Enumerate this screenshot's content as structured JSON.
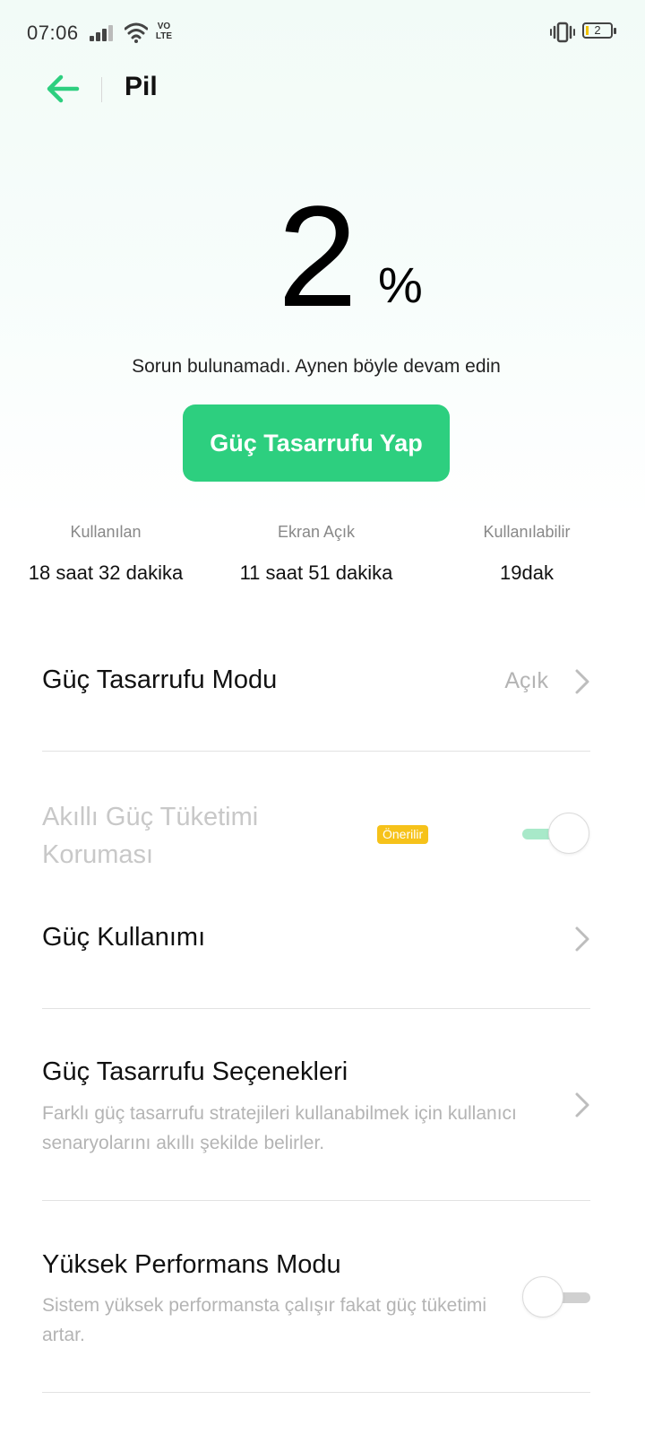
{
  "status_bar": {
    "time": "07:06",
    "network_icon_text": "VO LTE",
    "battery_level": "2"
  },
  "header": {
    "title": "Pil"
  },
  "battery": {
    "percent": "2",
    "percent_sign": "%",
    "message": "Sorun bulunamadı. Aynen böyle devam edin",
    "action_label": "Güç Tasarrufu Yap"
  },
  "stats": [
    {
      "label": "Kullanılan",
      "value": "18 saat 32 dakika"
    },
    {
      "label": "Ekran Açık",
      "value": "11 saat 51 dakika"
    },
    {
      "label": "Kullanılabilir",
      "value": "19dak"
    }
  ],
  "settings": {
    "power_saving_mode": {
      "title": "Güç Tasarrufu Modu",
      "value": "Açık"
    },
    "smart_protection": {
      "title": "Akıllı Güç Tüketimi Koruması",
      "badge": "Önerilir",
      "enabled": true,
      "disabled": true
    },
    "power_usage": {
      "title": "Güç Kullanımı"
    },
    "power_saving_options": {
      "title": "Güç Tasarrufu Seçenekleri",
      "subtitle": "Farklı güç tasarrufu stratejileri kullanabilmek için kullanıcı senaryolarını akıllı şekilde belirler."
    },
    "high_performance": {
      "title": "Yüksek Performans Modu",
      "subtitle": "Sistem yüksek performansta çalışır fakat güç tüketimi artar.",
      "enabled": false
    }
  },
  "colors": {
    "accent": "#2dcf7f",
    "badge": "#f6c21a"
  }
}
